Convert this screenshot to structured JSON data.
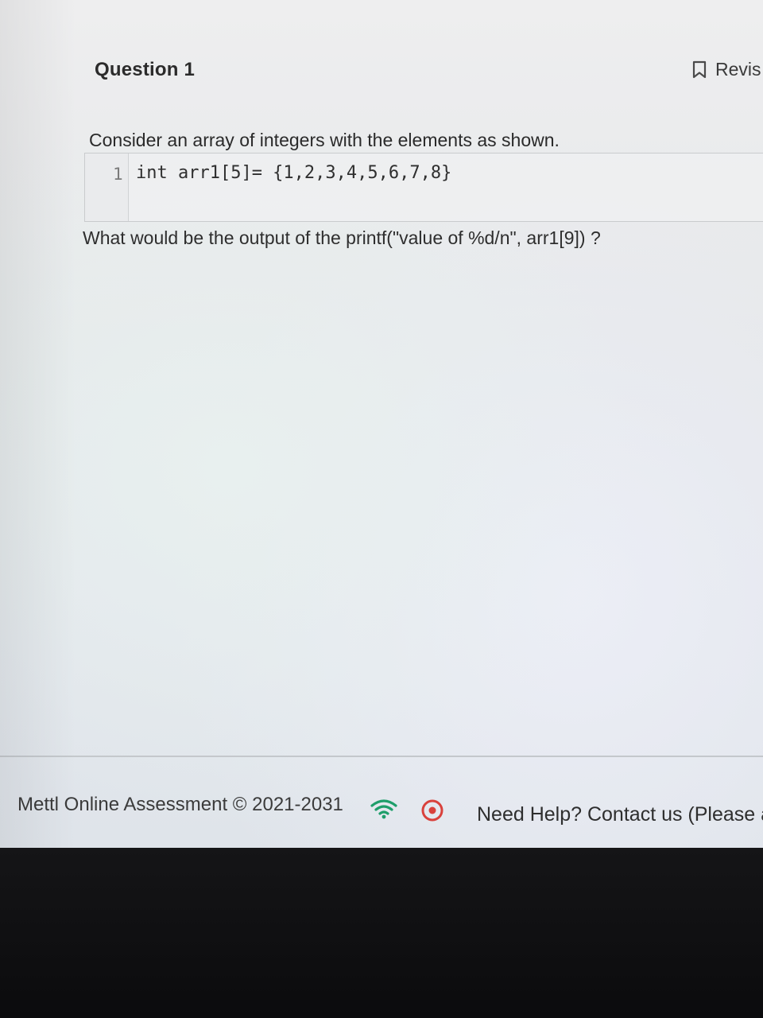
{
  "question": {
    "title": "Question 1",
    "revise_label": "Revis",
    "prompt": "Consider an array of integers with the elements as shown.",
    "code": {
      "line_number": "1",
      "line": "int arr1[5]= {1,2,3,4,5,6,7,8}"
    },
    "text": "What would be the output of the printf(\"value of %d/n\", arr1[9]) ?"
  },
  "footer": {
    "copyright": "Mettl Online Assessment © 2021-2031",
    "help": "Need Help? Contact us (Please ac"
  },
  "colors": {
    "record_red": "#d9413c",
    "wifi_green": "#1e9e6a"
  }
}
